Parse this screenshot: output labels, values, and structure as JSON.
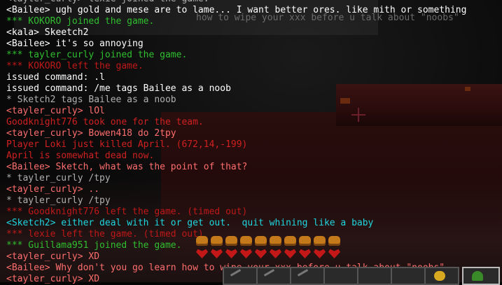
{
  "chat": [
    {
      "text": "<tayler_curly> lexie joined the game.",
      "color": "gray"
    },
    {
      "text": "<Bailee> ugh gold and mese are to lame... I want better ores. like mith or something",
      "color": "white"
    },
    {
      "text": "*** KOKORO joined the game.",
      "color": "green"
    },
    {
      "text": "<kala> Skeetch2",
      "color": "white"
    },
    {
      "text": "<Bailee> it's so annoying",
      "color": "white"
    },
    {
      "text": "*** tayler_curly joined the game.",
      "color": "green"
    },
    {
      "text": "*** KOKORO left the game.",
      "color": "dimred"
    },
    {
      "text": "issued command: .l",
      "color": "white"
    },
    {
      "text": "issued command: /me tags Bailee as a noob",
      "color": "white"
    },
    {
      "text": "* Sketch2 tags Bailee as a noob",
      "color": "gray"
    },
    {
      "text": "<tayler_curly> lOl",
      "color": "salmon"
    },
    {
      "text": "Goodknight776 took one for the team.",
      "color": "red"
    },
    {
      "text": "<tayler_curly> Bowen418 do 2tpy",
      "color": "salmon"
    },
    {
      "text": "Player Loki just killed April. (672,14,-199)",
      "color": "red"
    },
    {
      "text": "April is somewhat dead now.",
      "color": "red"
    },
    {
      "text": "<Bailee> Sketch, what was the point of that?",
      "color": "salmon"
    },
    {
      "text": "* tayler_curly /tpy",
      "color": "gray"
    },
    {
      "text": "<tayler_curly> ..",
      "color": "salmon"
    },
    {
      "text": "* tayler_curly /tpy",
      "color": "gray"
    },
    {
      "text": "*** Goodknight776 left the game. (timed out)",
      "color": "dimred"
    },
    {
      "text": "<Sketch2> either deal with it or get out.  quit whining like a baby",
      "color": "cyan"
    },
    {
      "text": "*** lexie left the game. (timed out)",
      "color": "dimred"
    },
    {
      "text": "*** Guillama951 joined the game.",
      "color": "green"
    },
    {
      "text": "<tayler_curly> XD",
      "color": "salmon"
    },
    {
      "text": "<Bailee> Why don't you go learn how to wipe your xxx before u talk about \"noobs\"",
      "color": "salmon"
    },
    {
      "text": "<tayler_curly> XD",
      "color": "salmon"
    }
  ],
  "faint_overlay": "how to wipe your xxx before u talk about \"noobs\"",
  "hud": {
    "food_count": 10,
    "health_count": 10
  },
  "colors": {
    "white": "#ffffff",
    "green": "#2fbf2f",
    "red": "#d02020",
    "gray": "#b0b0b0",
    "salmon": "#ff6e6e",
    "cyan": "#1fd6e0",
    "dimred": "#c01818"
  }
}
